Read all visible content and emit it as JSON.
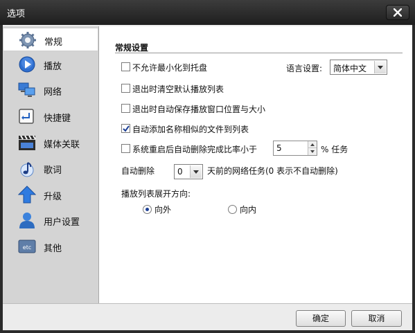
{
  "window": {
    "title": "选项"
  },
  "sidebar": {
    "items": [
      {
        "label": "常规",
        "icon": "gear-icon",
        "active": true
      },
      {
        "label": "播放",
        "icon": "play-icon"
      },
      {
        "label": "网络",
        "icon": "network-icon"
      },
      {
        "label": "快捷键",
        "icon": "enter-key-icon"
      },
      {
        "label": "媒体关联",
        "icon": "clapperboard-icon"
      },
      {
        "label": "歌词",
        "icon": "music-note-icon"
      },
      {
        "label": "升级",
        "icon": "up-arrow-icon"
      },
      {
        "label": "用户设置",
        "icon": "user-icon"
      },
      {
        "label": "其他",
        "icon": "etc-icon"
      }
    ]
  },
  "general": {
    "section_title": "常规设置",
    "options": [
      {
        "label": "不允许最小化到托盘",
        "checked": false
      },
      {
        "label": "退出时清空默认播放列表",
        "checked": false
      },
      {
        "label": "退出时自动保存播放窗口位置与大小",
        "checked": false
      },
      {
        "label": "自动添加名称相似的文件到列表",
        "checked": true
      },
      {
        "label": "系统重启后自动删除完成比率小于",
        "checked": false
      }
    ],
    "language": {
      "label": "语言设置:",
      "value": "简体中文"
    },
    "ratio": {
      "value": "5",
      "suffix": "% 任务"
    },
    "auto_delete": {
      "label": "自动删除",
      "value": "0",
      "suffix": "天前的网络任务(0 表示不自动删除)"
    },
    "expand_direction": {
      "label": "播放列表展开方向:",
      "options": [
        {
          "label": "向外",
          "selected": true
        },
        {
          "label": "向内",
          "selected": false
        }
      ]
    }
  },
  "buttons": {
    "ok": "确定",
    "cancel": "取消"
  },
  "colors": {
    "accent": "#1c3f95",
    "titlebar": "#262626",
    "sidebar": "#d4d4d4"
  }
}
